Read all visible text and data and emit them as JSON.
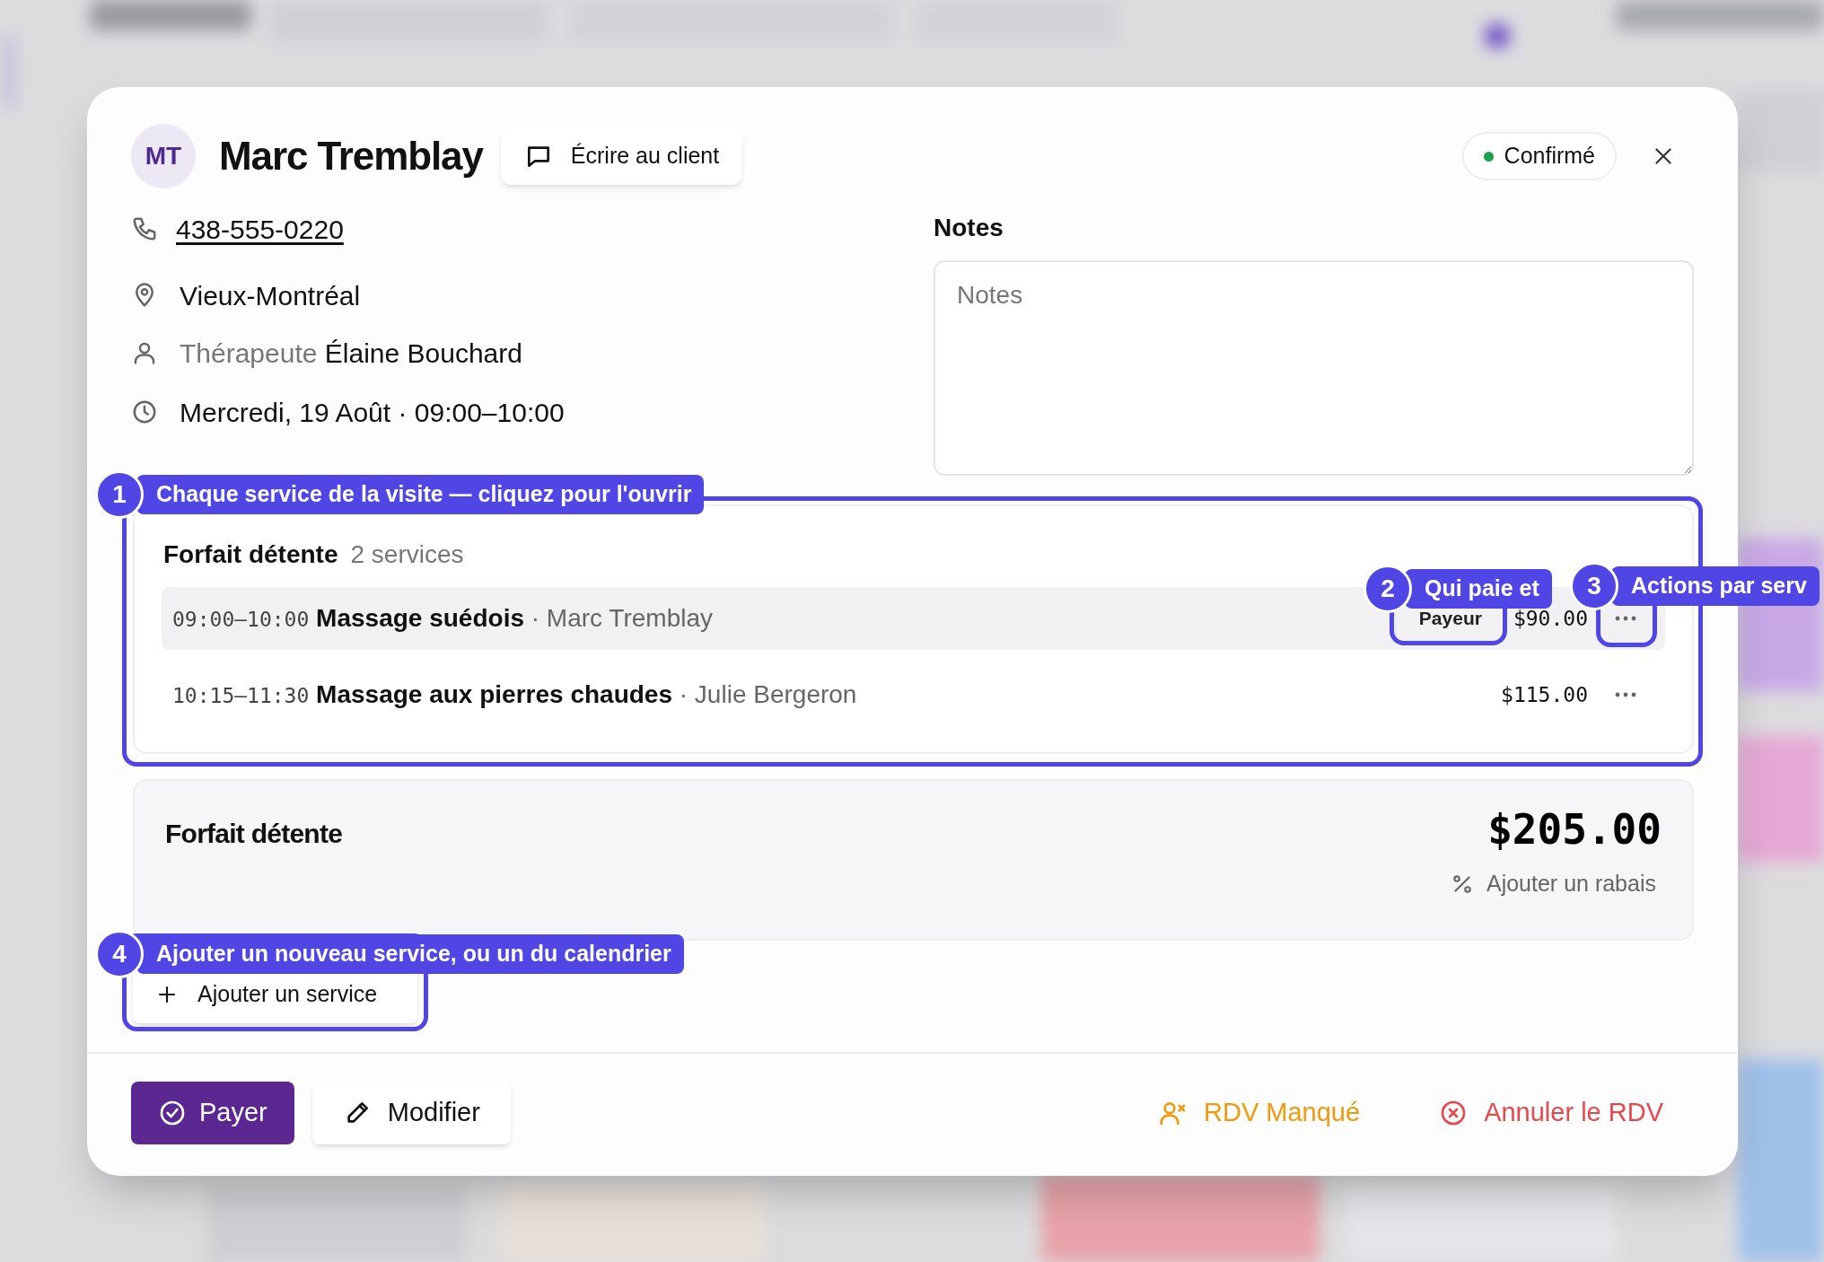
{
  "client": {
    "initials": "MT",
    "name": "Marc Tremblay"
  },
  "write_button": "Écrire au client",
  "status": {
    "label": "Confirmé",
    "color": "#16a34a"
  },
  "phone": "438-555-0220",
  "location": "Vieux-Montréal",
  "therapist": {
    "label": "Thérapeute",
    "value": "Élaine Bouchard"
  },
  "datetime": "Mercredi, 19 Août · 09:00–10:00",
  "notes": {
    "label": "Notes",
    "placeholder": "Notes"
  },
  "package": {
    "name": "Forfait détente",
    "count": "2 services",
    "services": [
      {
        "time": "09:00–10:00",
        "name": "Massage suédois",
        "staff": "· Marc Tremblay",
        "payer": "Payeur",
        "price": "$90.00",
        "selected": true
      },
      {
        "time": "10:15–11:30",
        "name": "Massage aux pierres chaudes",
        "staff": "· Julie Bergeron",
        "price": "$115.00",
        "selected": false
      }
    ]
  },
  "total": {
    "label": "Forfait détente",
    "amount": "$205.00",
    "discount": "Ajouter un rabais"
  },
  "add_service": "Ajouter un service",
  "footer_buttons": [
    {
      "kind": "primary",
      "label": "Payer"
    },
    {
      "kind": "secondary",
      "label": "Modifier"
    },
    {
      "kind": "warning",
      "label": "RDV Manqué"
    },
    {
      "kind": "danger",
      "label": "Annuler le RDV"
    }
  ],
  "callouts": [
    {
      "number": "1",
      "text": "Chaque service de la visite — cliquez pour l'ouvrir"
    },
    {
      "number": "2",
      "text": "Qui paie et"
    },
    {
      "number": "3",
      "text": "Actions par serv"
    },
    {
      "number": "4",
      "text": "Ajouter un nouveau service, ou un du calendrier"
    }
  ]
}
